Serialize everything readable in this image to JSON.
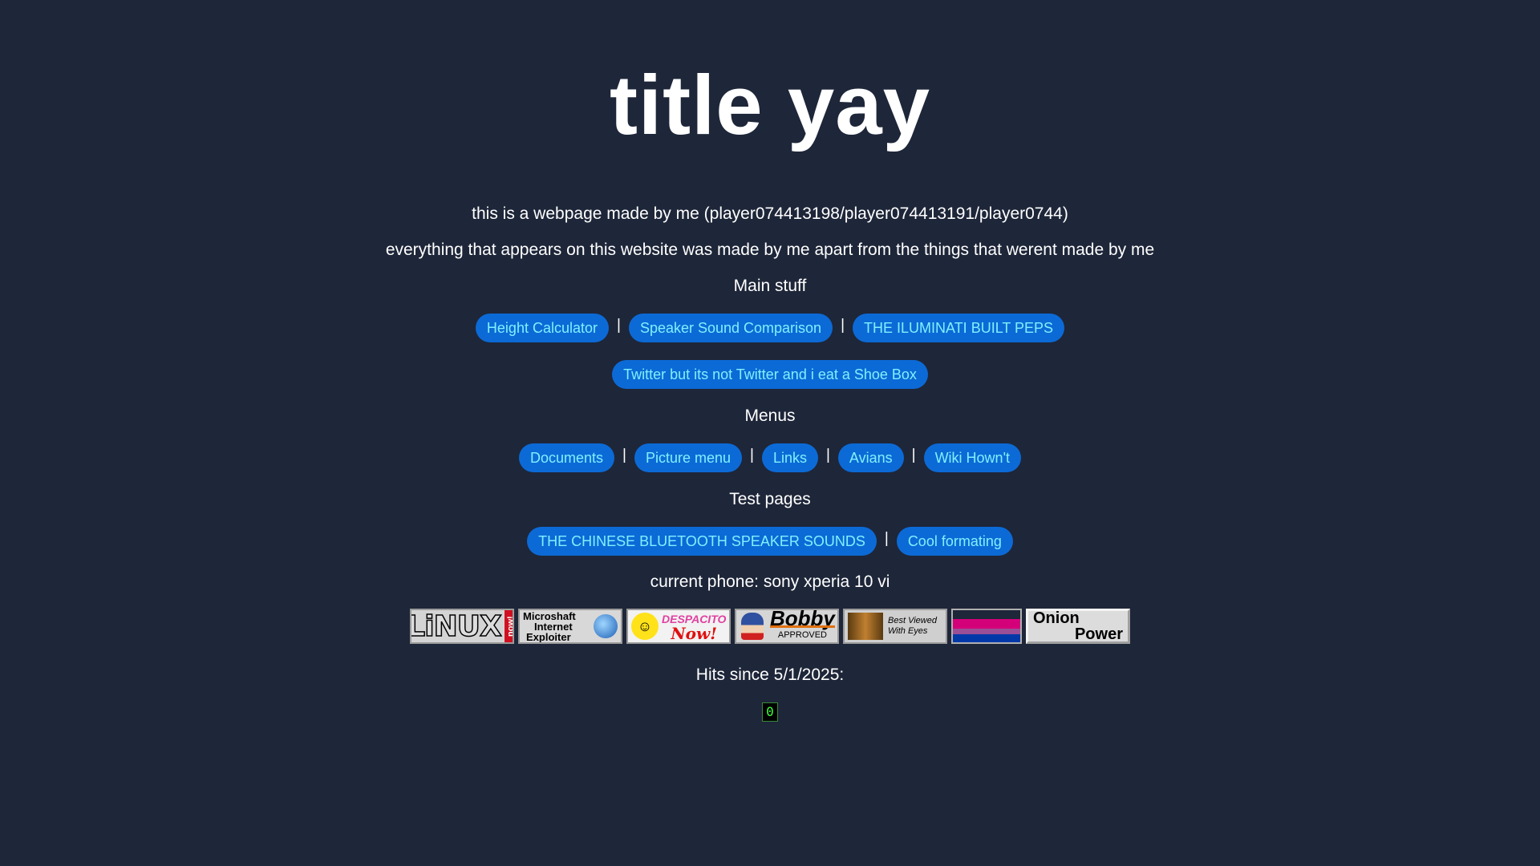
{
  "title": "title yay",
  "intro": {
    "line1": "this is a webpage made by me (player074413198/player074413191/player0744)",
    "line2": "everything that appears on this website was made by me apart from the things that werent made by me"
  },
  "main_stuff": {
    "heading": "Main stuff",
    "buttons": [
      "Height Calculator",
      "Speaker Sound Comparison",
      "THE ILUMINATI BUILT PEPS",
      "Twitter but its not Twitter and i eat a Shoe Box"
    ]
  },
  "menus": {
    "heading": "Menus",
    "buttons": [
      "Documents",
      "Picture menu",
      "Links",
      "Avians",
      "Wiki Hown't"
    ]
  },
  "test_pages": {
    "heading": "Test pages",
    "buttons": [
      "THE CHINESE BLUETOOTH SPEAKER SOUNDS",
      "Cool formating"
    ]
  },
  "separator": "|",
  "current_phone": "current phone: sony xperia 10 vi",
  "badges": [
    {
      "text1": "LiNUX",
      "text2": "now!"
    },
    {
      "text1": "Microshaft",
      "text2": "Internet",
      "text3": "Exploiter"
    },
    {
      "text1": "DESPACITO",
      "text2": "Now!"
    },
    {
      "text1": "Bobby",
      "text2": "APPROVED"
    },
    {
      "text1": "Best Viewed",
      "text2": "With Eyes"
    },
    {
      "text1": ""
    },
    {
      "text1": "Onion",
      "text2": "Power"
    }
  ],
  "hits": {
    "label": "Hits since 5/1/2025:",
    "count": "0"
  },
  "colors": {
    "background": "#1e2639",
    "button_bg": "#0c6ad6",
    "button_text": "#7ff0ff",
    "counter_green": "#3cff3c"
  }
}
